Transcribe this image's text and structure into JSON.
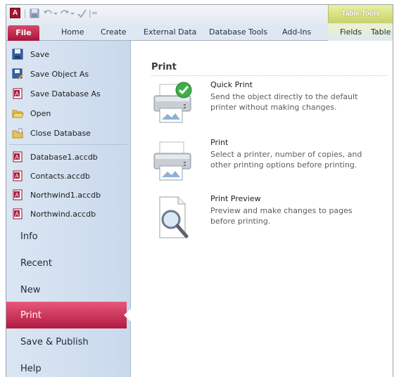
{
  "app": {
    "icon_letter": "A"
  },
  "quick_access": {
    "customize_glyph": "|="
  },
  "context_group": {
    "label": "Table Tools"
  },
  "ribbon": {
    "tabs": [
      {
        "label": "File"
      },
      {
        "label": "Home"
      },
      {
        "label": "Create"
      },
      {
        "label": "External Data"
      },
      {
        "label": "Database Tools"
      },
      {
        "label": "Add-Ins"
      },
      {
        "label": "Fields"
      },
      {
        "label": "Table"
      }
    ]
  },
  "nav": {
    "commands": [
      {
        "label": "Save",
        "icon": "save-icon"
      },
      {
        "label": "Save Object As",
        "icon": "save-object-as-icon"
      },
      {
        "label": "Save Database As",
        "icon": "save-database-as-icon"
      },
      {
        "label": "Open",
        "icon": "open-folder-icon"
      },
      {
        "label": "Close Database",
        "icon": "close-database-icon"
      }
    ],
    "recent_files": [
      {
        "label": "Database1.accdb"
      },
      {
        "label": "Contacts.accdb"
      },
      {
        "label": "Northwind1.accdb"
      },
      {
        "label": "Northwind.accdb"
      }
    ],
    "sections": [
      {
        "label": "Info"
      },
      {
        "label": "Recent"
      },
      {
        "label": "New"
      },
      {
        "label": "Print",
        "active": true
      },
      {
        "label": "Save & Publish"
      },
      {
        "label": "Help"
      }
    ]
  },
  "main": {
    "title": "Print",
    "options": [
      {
        "title": "Quick Print",
        "description": "Send the object directly to the default printer without making changes.",
        "icon": "quick-print-icon"
      },
      {
        "title": "Print",
        "description": "Select a printer, number of copies, and other printing options before printing.",
        "icon": "printer-icon"
      },
      {
        "title": "Print Preview",
        "description": "Preview and make changes to pages before printing.",
        "icon": "print-preview-icon"
      }
    ]
  },
  "colors": {
    "file_tab": "#b31a40",
    "nav_background": "#d3e1f1",
    "active_section": "#c8234d",
    "context_group": "#d6df80"
  }
}
